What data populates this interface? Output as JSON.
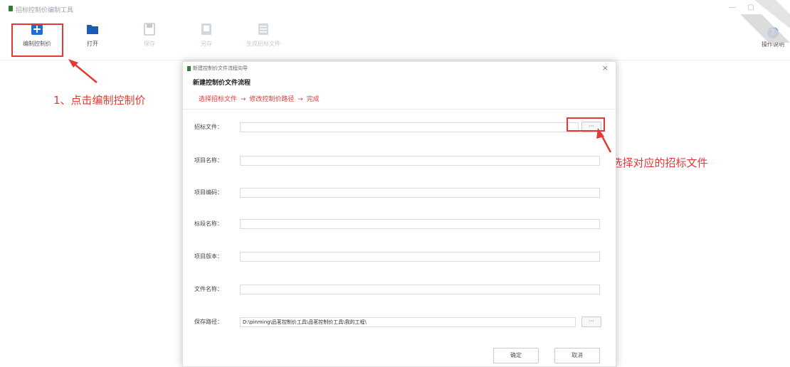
{
  "window": {
    "title": "招标控制价编制工具",
    "controls": [
      "—",
      "▢",
      "✕"
    ]
  },
  "toolbar": {
    "buttons": [
      {
        "label": "编制控制价",
        "icon": "plus-square-icon",
        "enabled": true
      },
      {
        "label": "打开",
        "icon": "folder-icon",
        "enabled": true
      },
      {
        "label": "保存",
        "icon": "save-icon",
        "enabled": false
      },
      {
        "label": "另存",
        "icon": "save-as-icon",
        "enabled": false
      },
      {
        "label": "生成招标文件",
        "icon": "export-icon",
        "enabled": false
      }
    ],
    "help_label": "操作说明"
  },
  "annotations": {
    "step1": "1、点击编制控制价",
    "step2": "2、选择对应的招标文件"
  },
  "dialog": {
    "title": "新建控制价文件流程向导",
    "heading": "新建控制价文件流程",
    "steps": [
      "选择招标文件",
      "→",
      "修改控制价路径",
      "→",
      "完成"
    ],
    "fields": [
      {
        "label": "招标文件：",
        "value": "",
        "has_browse": true
      },
      {
        "label": "项目名称：",
        "value": "",
        "has_browse": false
      },
      {
        "label": "项目编码：",
        "value": "",
        "has_browse": false
      },
      {
        "label": "标段名称：",
        "value": "",
        "has_browse": false
      },
      {
        "label": "项目版本：",
        "value": "",
        "has_browse": false
      },
      {
        "label": "文件名称：",
        "value": "",
        "has_browse": false
      },
      {
        "label": "保存路径：",
        "value": "D:\\pinming\\品茗控制价工具\\品茗控制价工具\\我的工程\\",
        "has_browse": true
      }
    ],
    "browse_label": "···",
    "ok_label": "确定",
    "cancel_label": "取消",
    "close_label": "×"
  },
  "colors": {
    "accent": "#1e6fd9",
    "annotation": "#e53935",
    "logo": "#2e7d32"
  }
}
